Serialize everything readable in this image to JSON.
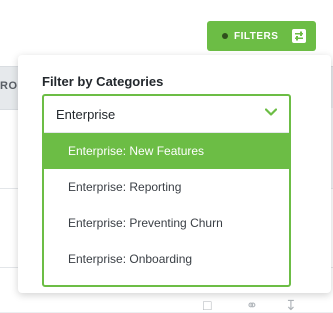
{
  "toolbar": {
    "filters_label": "FILTERS"
  },
  "table": {
    "header_fragment": "RO"
  },
  "filter_panel": {
    "title": "Filter by Categories",
    "selected_value": "Enterprise",
    "options": [
      {
        "label": "Enterprise: New Features",
        "active": true
      },
      {
        "label": "Enterprise: Reporting",
        "active": false
      },
      {
        "label": "Enterprise: Preventing Churn",
        "active": false
      },
      {
        "label": "Enterprise: Onboarding",
        "active": false
      }
    ]
  },
  "icons": {
    "filters": "sliders-icon",
    "dropdown": "chevron-down-icon",
    "row_actions": [
      "document-icon",
      "link-icon",
      "download-icon"
    ]
  },
  "colors": {
    "accent": "#6cbd45",
    "text": "#23282d"
  }
}
